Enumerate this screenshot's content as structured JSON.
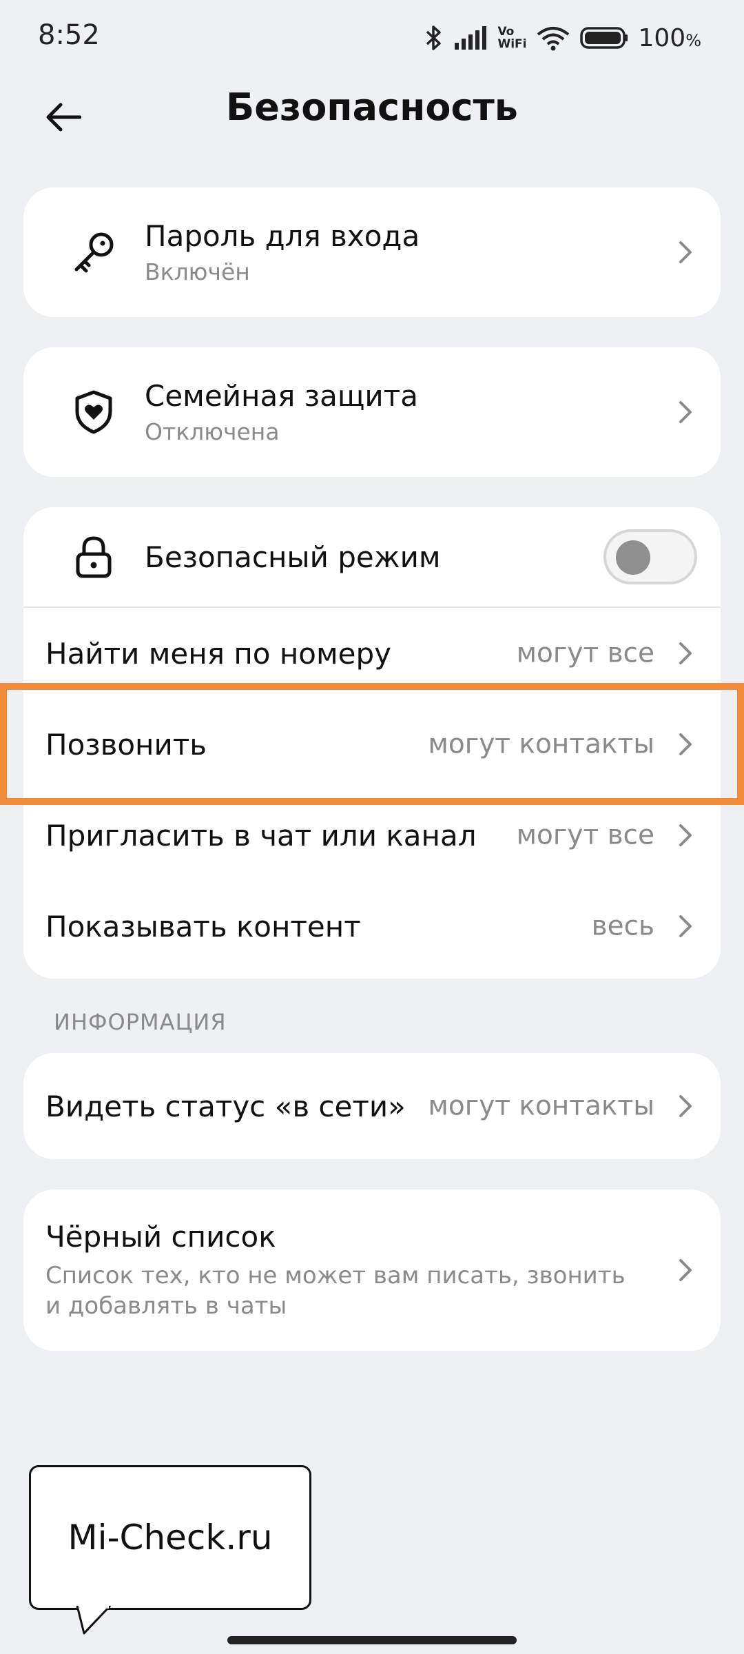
{
  "status_bar": {
    "time": "8:52",
    "vowifi_top": "Vo",
    "vowifi_bottom": "WiFi",
    "battery": "100",
    "battery_unit": "%",
    "icons": [
      "bluetooth-icon",
      "signal-icon",
      "vowifi-icon",
      "wifi-icon",
      "battery-icon"
    ]
  },
  "header": {
    "title": "Безопасность",
    "back_icon": "arrow-left-icon"
  },
  "cards": {
    "password": {
      "title": "Пароль для входа",
      "subtitle": "Включён",
      "icon": "key-icon"
    },
    "family": {
      "title": "Семейная защита",
      "subtitle": "Отключена",
      "icon": "shield-heart-icon"
    },
    "safe_mode": {
      "title": "Безопасный режим",
      "icon": "lock-icon",
      "enabled": false
    },
    "privacy_rows": [
      {
        "title": "Найти меня по номеру",
        "value": "могут все"
      },
      {
        "title": "Позвонить",
        "value": "могут контакты"
      },
      {
        "title": "Пригласить в чат или канал",
        "value": "могут все"
      },
      {
        "title": "Показывать контент",
        "value": "весь"
      }
    ]
  },
  "info_section": {
    "label": "ИНФОРМАЦИЯ",
    "online_status": {
      "title": "Видеть статус «в сети»",
      "value": "могут контакты"
    },
    "blacklist": {
      "title": "Чёрный список",
      "subtitle": "Список тех, кто не может вам писать, звонить и добавлять в чаты"
    }
  },
  "watermark": {
    "text": "Mi-Check.ru"
  },
  "colors": {
    "background": "#eef0f4",
    "card": "#ffffff",
    "highlight": "#f28c3b",
    "secondary_text": "#8a8a8a"
  }
}
